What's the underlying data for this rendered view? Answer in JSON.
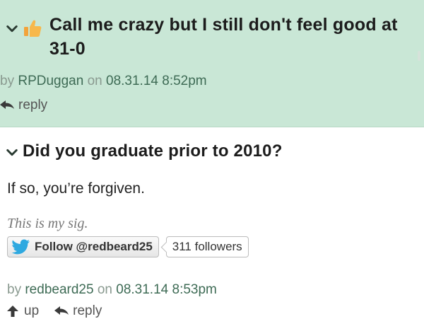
{
  "comments": [
    {
      "title": "Call me crazy but I still don't feel good at 31-0",
      "by_label": "by",
      "author": "RPDuggan",
      "on_label": "on",
      "timestamp": "08.31.14 8:52pm",
      "reply_label": "reply",
      "icon": "thumbs-up-icon",
      "highlight_color": "#c9e7d6"
    },
    {
      "title": "Did you graduate prior to 2010?",
      "body": "If so, you’re forgiven.",
      "signature": "This is my sig.",
      "follow_label": "Follow @redbeard25",
      "followers": "311 followers",
      "by_label": "by",
      "author": "redbeard25",
      "on_label": "on",
      "timestamp": "08.31.14 8:53pm",
      "up_label": "up",
      "reply_label": "reply"
    }
  ]
}
